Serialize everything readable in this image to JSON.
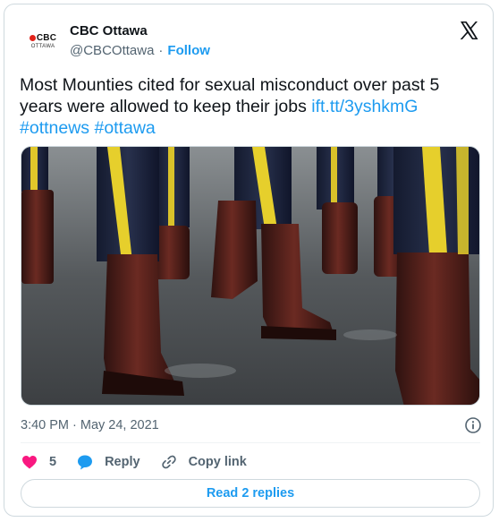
{
  "author": {
    "logo_brand": "CBC",
    "logo_city": "OTTAWA",
    "name": "CBC Ottawa",
    "handle": "@CBCOttawa",
    "separator": "·",
    "follow_label": "Follow"
  },
  "tweet": {
    "text": "Most Mounties cited for sexual misconduct over past 5 years were allowed to keep their jobs",
    "link": "ift.tt/3yshkmG",
    "hashtags": [
      "#ottnews",
      "#ottawa"
    ],
    "timestamp": "3:40 PM · May 24, 2021"
  },
  "actions": {
    "like_count": "5",
    "reply_label": "Reply",
    "copy_label": "Copy link",
    "read_replies_label": "Read 2 replies"
  },
  "colors": {
    "accent": "#1d9bf0",
    "like": "#f91880",
    "muted_text": "#536471",
    "brand_red": "#e2231a"
  },
  "icons": {
    "platform": "x-logo-icon",
    "info": "info-icon",
    "like": "heart-icon",
    "reply": "speech-bubble-icon",
    "copy": "link-icon"
  }
}
